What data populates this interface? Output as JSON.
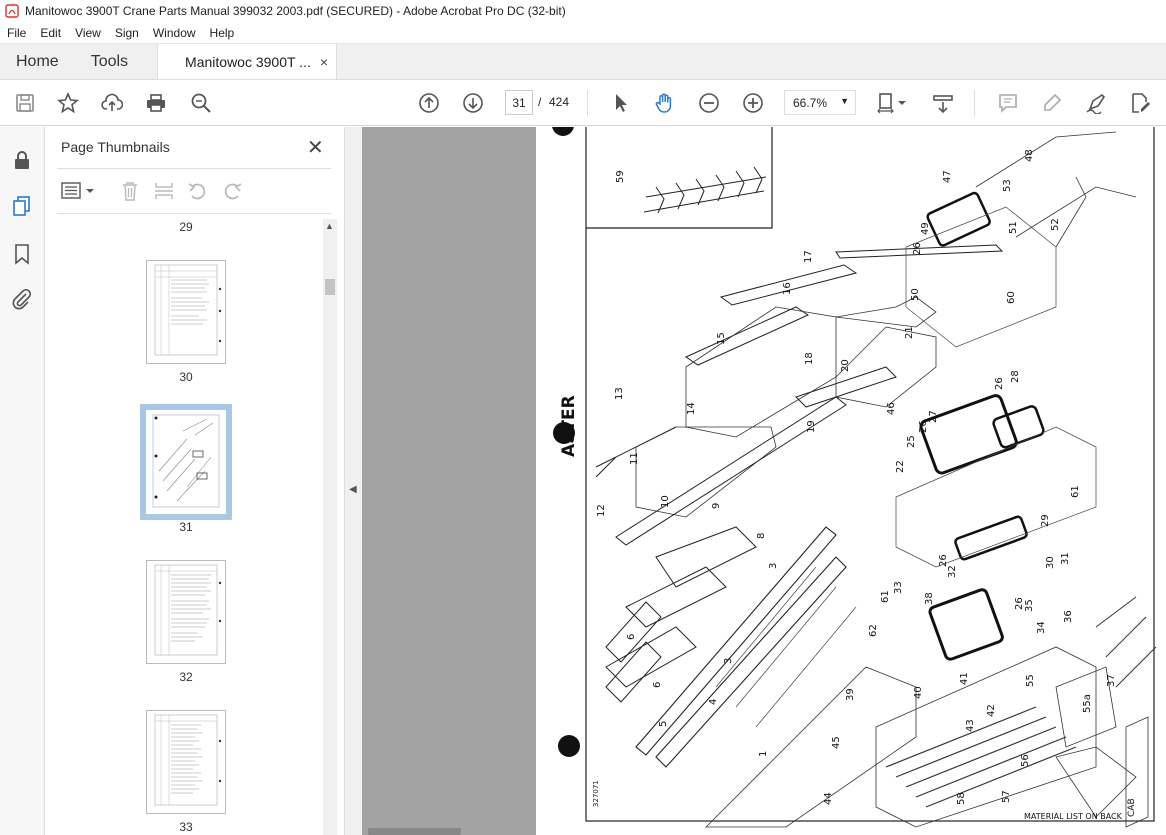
{
  "window": {
    "title": "Manitowoc 3900T Crane Parts Manual 399032 2003.pdf (SECURED) - Adobe Acrobat Pro DC (32-bit)"
  },
  "menu": [
    "File",
    "Edit",
    "View",
    "Sign",
    "Window",
    "Help"
  ],
  "tabs": {
    "home": "Home",
    "tools": "Tools",
    "document": "Manitowoc 3900T ...",
    "close": "×"
  },
  "toolbar": {
    "page_current": "31",
    "page_separator": "/",
    "page_total": "424",
    "zoom": "66.7%"
  },
  "panel": {
    "title": "Page Thumbnails",
    "close": "✕"
  },
  "thumbnails": [
    {
      "label": "29"
    },
    {
      "label": "30"
    },
    {
      "label": "31",
      "selected": true
    },
    {
      "label": "32"
    },
    {
      "label": "33"
    }
  ],
  "drawing": {
    "side_text": "ASTER",
    "catalog_no": "327071",
    "footer": "MATERIAL LIST ON BACK",
    "corner": "CAB",
    "callouts": [
      "59",
      "17",
      "16",
      "15",
      "14",
      "13",
      "11",
      "12",
      "10",
      "9",
      "8",
      "3",
      "6",
      "6",
      "5",
      "4",
      "3",
      "1",
      "18",
      "19",
      "20",
      "21",
      "46",
      "47",
      "48",
      "53",
      "49",
      "26",
      "51",
      "52",
      "50",
      "60",
      "27",
      "26",
      "25",
      "28",
      "26",
      "22",
      "61",
      "29",
      "30",
      "31",
      "32",
      "26",
      "33",
      "38",
      "35",
      "36",
      "26",
      "34",
      "61",
      "62",
      "39",
      "40",
      "41",
      "42",
      "43",
      "55",
      "55a",
      "45",
      "44",
      "58",
      "57",
      "56",
      "37"
    ]
  }
}
